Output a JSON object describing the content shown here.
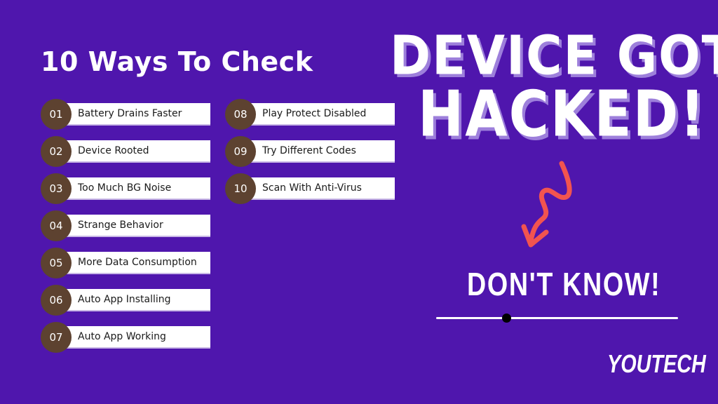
{
  "title": "10 Ways To Check",
  "items": [
    {
      "num": "01",
      "label": "Battery Drains Faster"
    },
    {
      "num": "02",
      "label": "Device Rooted"
    },
    {
      "num": "03",
      "label": "Too Much BG Noise"
    },
    {
      "num": "04",
      "label": "Strange Behavior"
    },
    {
      "num": "05",
      "label": "More Data Consumption"
    },
    {
      "num": "06",
      "label": "Auto App Installing"
    },
    {
      "num": "07",
      "label": "Auto App Working"
    },
    {
      "num": "08",
      "label": "Play Protect Disabled"
    },
    {
      "num": "09",
      "label": "Try Different Codes"
    },
    {
      "num": "10",
      "label": "Scan With Anti-Virus"
    }
  ],
  "headline": {
    "line1": "DEVICE GOT",
    "line2": "HACKED!"
  },
  "subheadline": "DON'T KNOW!",
  "brand": "YOUTECH",
  "colors": {
    "background": "#4f16ad",
    "badge": "#5d4230",
    "arrow": "#f2544f",
    "shadow": "#9d7fdb"
  }
}
